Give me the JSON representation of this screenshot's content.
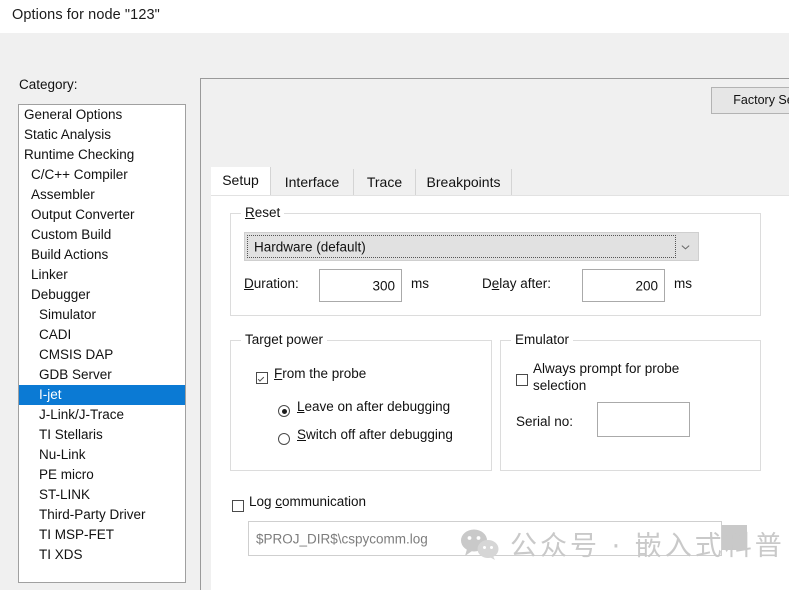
{
  "window": {
    "title": "Options for node \"123\""
  },
  "category": {
    "label": "Category:",
    "items": [
      {
        "label": "General Options",
        "indent": 0,
        "selected": false
      },
      {
        "label": "Static Analysis",
        "indent": 0,
        "selected": false
      },
      {
        "label": "Runtime Checking",
        "indent": 0,
        "selected": false
      },
      {
        "label": "C/C++ Compiler",
        "indent": 1,
        "selected": false
      },
      {
        "label": "Assembler",
        "indent": 1,
        "selected": false
      },
      {
        "label": "Output Converter",
        "indent": 1,
        "selected": false
      },
      {
        "label": "Custom Build",
        "indent": 1,
        "selected": false
      },
      {
        "label": "Build Actions",
        "indent": 1,
        "selected": false
      },
      {
        "label": "Linker",
        "indent": 1,
        "selected": false
      },
      {
        "label": "Debugger",
        "indent": 1,
        "selected": false
      },
      {
        "label": "Simulator",
        "indent": 2,
        "selected": false
      },
      {
        "label": "CADI",
        "indent": 2,
        "selected": false
      },
      {
        "label": "CMSIS DAP",
        "indent": 2,
        "selected": false
      },
      {
        "label": "GDB Server",
        "indent": 2,
        "selected": false
      },
      {
        "label": "I-jet",
        "indent": 2,
        "selected": true
      },
      {
        "label": "J-Link/J-Trace",
        "indent": 2,
        "selected": false
      },
      {
        "label": "TI Stellaris",
        "indent": 2,
        "selected": false
      },
      {
        "label": "Nu-Link",
        "indent": 2,
        "selected": false
      },
      {
        "label": "PE micro",
        "indent": 2,
        "selected": false
      },
      {
        "label": "ST-LINK",
        "indent": 2,
        "selected": false
      },
      {
        "label": "Third-Party Driver",
        "indent": 2,
        "selected": false
      },
      {
        "label": "TI MSP-FET",
        "indent": 2,
        "selected": false
      },
      {
        "label": "TI XDS",
        "indent": 2,
        "selected": false
      }
    ]
  },
  "toolbar": {
    "factory_settings_label": "Factory Se"
  },
  "tabs": [
    {
      "label": "Setup",
      "active": true
    },
    {
      "label": "Interface",
      "active": false
    },
    {
      "label": "Trace",
      "active": false
    },
    {
      "label": "Breakpoints",
      "active": false
    }
  ],
  "reset_group": {
    "title_acc": "R",
    "title_rest": "eset",
    "combo_value": "Hardware (default)",
    "duration": {
      "label_acc": "D",
      "label_rest": "uration:",
      "value": "300",
      "unit": "ms"
    },
    "delay_after": {
      "label_pre": "D",
      "label_acc": "e",
      "label_rest": "lay after:",
      "value": "200",
      "unit": "ms"
    }
  },
  "target_power_group": {
    "title": "Target power",
    "from_probe": {
      "label_pre": "",
      "label_acc": "F",
      "label_rest": "rom the probe",
      "checked": true
    },
    "leave_on": {
      "label_acc": "L",
      "label_rest": "eave on after debugging",
      "selected": true
    },
    "switch_off": {
      "label_acc": "S",
      "label_rest": "witch off after debugging",
      "selected": false
    }
  },
  "emulator_group": {
    "title": "Emulator",
    "always_prompt": {
      "label": "Always prompt for probe selection",
      "checked": false
    },
    "serial_no": {
      "label": "Serial no:",
      "value": ""
    }
  },
  "log_communication": {
    "label_pre": "Log ",
    "label_acc": "c",
    "label_rest": "ommunication",
    "checked": false,
    "path_value": "$PROJ_DIR$\\cspycomm.log"
  },
  "watermark": {
    "text": "公众号 · 嵌入式科普"
  },
  "colors": {
    "selection": "#0b7ad4",
    "dialog_bg": "#f0f0f0",
    "pane_bg": "#ffffff"
  }
}
